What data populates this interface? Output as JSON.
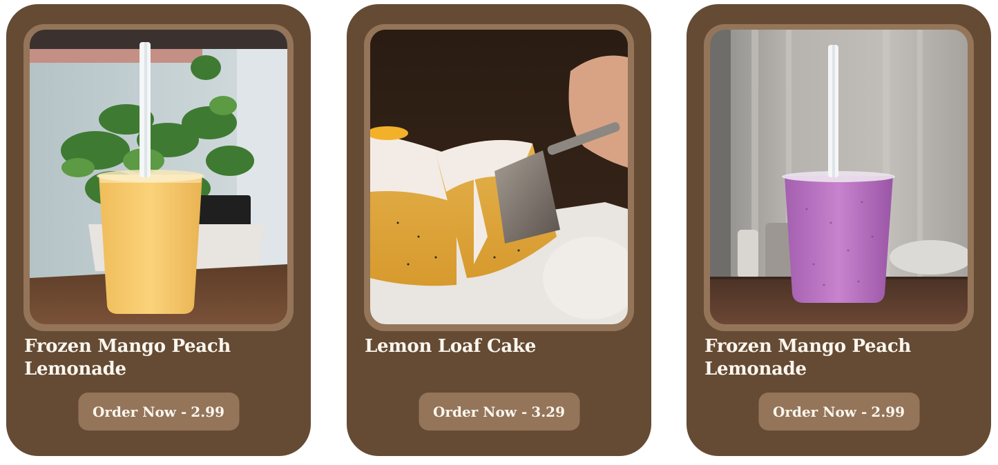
{
  "colors": {
    "card_background": "#654b34",
    "frame_and_button": "#947559",
    "text": "#fbf6ef"
  },
  "products": [
    {
      "title": "Frozen Mango Peach Lemonade",
      "button_prefix": "Order Now -",
      "price": "2.99",
      "image": "mango-peach-lemonade-photo"
    },
    {
      "title": "Lemon Loaf Cake",
      "button_prefix": "Order Now -",
      "price": "3.29",
      "image": "lemon-loaf-cake-photo"
    },
    {
      "title": "Frozen Mango Peach Lemonade",
      "button_prefix": "Order Now -",
      "price": "2.99",
      "image": "berry-smoothie-photo"
    }
  ]
}
